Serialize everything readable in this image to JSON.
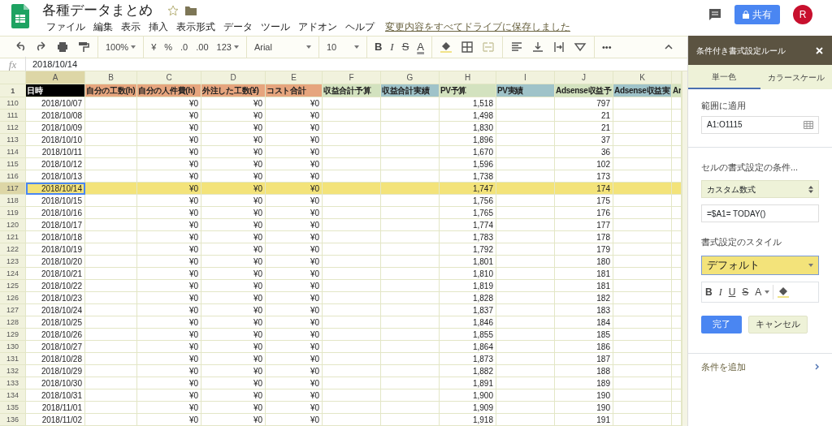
{
  "document": {
    "title": "各種データまとめ",
    "save_status": "変更内容をすべてドライブに保存しました"
  },
  "menus": [
    "ファイル",
    "編集",
    "表示",
    "挿入",
    "表示形式",
    "データ",
    "ツール",
    "アドオン",
    "ヘルプ"
  ],
  "share_button": {
    "label": "共有"
  },
  "avatar": {
    "initial": "R"
  },
  "toolbar": [
    {
      "kind": "undo"
    },
    {
      "kind": "redo"
    },
    {
      "kind": "print"
    },
    {
      "kind": "paint"
    },
    {
      "kind": "sep"
    },
    {
      "kind": "dropdown",
      "text": "100%"
    },
    {
      "kind": "sep"
    },
    {
      "kind": "text",
      "text": "¥"
    },
    {
      "kind": "text",
      "text": "%"
    },
    {
      "kind": "text",
      "text": ".0"
    },
    {
      "kind": "text",
      "text": ".00"
    },
    {
      "kind": "dropdown",
      "text": "123"
    },
    {
      "kind": "sep"
    },
    {
      "kind": "wide",
      "text": "Arial"
    },
    {
      "kind": "sep"
    },
    {
      "kind": "wide",
      "text": "10"
    },
    {
      "kind": "sep"
    },
    {
      "kind": "bold",
      "text": "B"
    },
    {
      "kind": "italic",
      "text": "I"
    },
    {
      "kind": "strike",
      "text": "S"
    },
    {
      "kind": "color",
      "text": "A"
    },
    {
      "kind": "sep"
    },
    {
      "kind": "fill"
    },
    {
      "kind": "borders"
    },
    {
      "kind": "merge"
    },
    {
      "kind": "sep"
    },
    {
      "kind": "align"
    },
    {
      "kind": "valign"
    },
    {
      "kind": "wrap"
    },
    {
      "kind": "rotate"
    },
    {
      "kind": "sep"
    },
    {
      "kind": "text",
      "text": "•••"
    }
  ],
  "formula_bar": {
    "label": "fx",
    "value": "2018/10/14"
  },
  "sheet": {
    "header_row_number": "1",
    "columns": [
      {
        "letter": "A",
        "header": "日時",
        "color": "#000000",
        "selected": true
      },
      {
        "letter": "B",
        "header": "自分の工数(h)",
        "color": "#e6a57e",
        "selected": false
      },
      {
        "letter": "C",
        "header": "自分の人件費(h)",
        "color": "#e6a57e",
        "selected": false
      },
      {
        "letter": "D",
        "header": "外注した工数(¥)",
        "color": "#e6a57e",
        "selected": false
      },
      {
        "letter": "E",
        "header": "コスト合計",
        "color": "#e6a57e",
        "selected": false
      },
      {
        "letter": "F",
        "header": "収益合計予算",
        "color": "#d3e2bf",
        "selected": false
      },
      {
        "letter": "G",
        "header": "収益合計実績",
        "color": "#9fc3c9",
        "selected": false
      },
      {
        "letter": "H",
        "header": "PV予算",
        "color": "#d3e2bf",
        "selected": false
      },
      {
        "letter": "I",
        "header": "PV実績",
        "color": "#9fc3c9",
        "selected": false
      },
      {
        "letter": "J",
        "header": "Adsense収益予",
        "color": "#d3e2bf",
        "selected": false
      },
      {
        "letter": "K",
        "header": "Adsense収益実",
        "color": "#9fc3c9",
        "selected": false
      },
      {
        "header": "Ar",
        "color": "#d3e2bf",
        "selected": false
      }
    ],
    "rows": [
      {
        "number": "110",
        "selected": false,
        "cells": {
          "A": "2018/10/07",
          "C": "¥0",
          "D": "¥0",
          "E": "¥0",
          "H": "1,518",
          "J": "797"
        }
      },
      {
        "number": "111",
        "selected": false,
        "cells": {
          "A": "2018/10/08",
          "C": "¥0",
          "D": "¥0",
          "E": "¥0",
          "H": "1,498",
          "J": "21"
        }
      },
      {
        "number": "112",
        "selected": false,
        "cells": {
          "A": "2018/10/09",
          "C": "¥0",
          "D": "¥0",
          "E": "¥0",
          "H": "1,830",
          "J": "21"
        }
      },
      {
        "number": "113",
        "selected": false,
        "cells": {
          "A": "2018/10/10",
          "C": "¥0",
          "D": "¥0",
          "E": "¥0",
          "H": "1,896",
          "J": "37"
        }
      },
      {
        "number": "114",
        "selected": false,
        "cells": {
          "A": "2018/10/11",
          "C": "¥0",
          "D": "¥0",
          "E": "¥0",
          "H": "1,670",
          "J": "36"
        }
      },
      {
        "number": "115",
        "selected": false,
        "cells": {
          "A": "2018/10/12",
          "C": "¥0",
          "D": "¥0",
          "E": "¥0",
          "H": "1,596",
          "J": "102"
        }
      },
      {
        "number": "116",
        "selected": false,
        "cells": {
          "A": "2018/10/13",
          "C": "¥0",
          "D": "¥0",
          "E": "¥0",
          "H": "1,738",
          "J": "173"
        }
      },
      {
        "number": "117",
        "selected": true,
        "cells": {
          "A": "2018/10/14",
          "C": "¥0",
          "D": "¥0",
          "E": "¥0",
          "H": "1,747",
          "J": "174"
        }
      },
      {
        "number": "118",
        "selected": false,
        "cells": {
          "A": "2018/10/15",
          "C": "¥0",
          "D": "¥0",
          "E": "¥0",
          "H": "1,756",
          "J": "175"
        }
      },
      {
        "number": "119",
        "selected": false,
        "cells": {
          "A": "2018/10/16",
          "C": "¥0",
          "D": "¥0",
          "E": "¥0",
          "H": "1,765",
          "J": "176"
        }
      },
      {
        "number": "120",
        "selected": false,
        "cells": {
          "A": "2018/10/17",
          "C": "¥0",
          "D": "¥0",
          "E": "¥0",
          "H": "1,774",
          "J": "177"
        }
      },
      {
        "number": "121",
        "selected": false,
        "cells": {
          "A": "2018/10/18",
          "C": "¥0",
          "D": "¥0",
          "E": "¥0",
          "H": "1,783",
          "J": "178"
        }
      },
      {
        "number": "122",
        "selected": false,
        "cells": {
          "A": "2018/10/19",
          "C": "¥0",
          "D": "¥0",
          "E": "¥0",
          "H": "1,792",
          "J": "179"
        }
      },
      {
        "number": "123",
        "selected": false,
        "cells": {
          "A": "2018/10/20",
          "C": "¥0",
          "D": "¥0",
          "E": "¥0",
          "H": "1,801",
          "J": "180"
        }
      },
      {
        "number": "124",
        "selected": false,
        "cells": {
          "A": "2018/10/21",
          "C": "¥0",
          "D": "¥0",
          "E": "¥0",
          "H": "1,810",
          "J": "181"
        }
      },
      {
        "number": "125",
        "selected": false,
        "cells": {
          "A": "2018/10/22",
          "C": "¥0",
          "D": "¥0",
          "E": "¥0",
          "H": "1,819",
          "J": "181"
        }
      },
      {
        "number": "126",
        "selected": false,
        "cells": {
          "A": "2018/10/23",
          "C": "¥0",
          "D": "¥0",
          "E": "¥0",
          "H": "1,828",
          "J": "182"
        }
      },
      {
        "number": "127",
        "selected": false,
        "cells": {
          "A": "2018/10/24",
          "C": "¥0",
          "D": "¥0",
          "E": "¥0",
          "H": "1,837",
          "J": "183"
        }
      },
      {
        "number": "128",
        "selected": false,
        "cells": {
          "A": "2018/10/25",
          "C": "¥0",
          "D": "¥0",
          "E": "¥0",
          "H": "1,846",
          "J": "184"
        }
      },
      {
        "number": "129",
        "selected": false,
        "cells": {
          "A": "2018/10/26",
          "C": "¥0",
          "D": "¥0",
          "E": "¥0",
          "H": "1,855",
          "J": "185"
        }
      },
      {
        "number": "130",
        "selected": false,
        "cells": {
          "A": "2018/10/27",
          "C": "¥0",
          "D": "¥0",
          "E": "¥0",
          "H": "1,864",
          "J": "186"
        }
      },
      {
        "number": "131",
        "selected": false,
        "cells": {
          "A": "2018/10/28",
          "C": "¥0",
          "D": "¥0",
          "E": "¥0",
          "H": "1,873",
          "J": "187"
        }
      },
      {
        "number": "132",
        "selected": false,
        "cells": {
          "A": "2018/10/29",
          "C": "¥0",
          "D": "¥0",
          "E": "¥0",
          "H": "1,882",
          "J": "188"
        }
      },
      {
        "number": "133",
        "selected": false,
        "cells": {
          "A": "2018/10/30",
          "C": "¥0",
          "D": "¥0",
          "E": "¥0",
          "H": "1,891",
          "J": "189"
        }
      },
      {
        "number": "134",
        "selected": false,
        "cells": {
          "A": "2018/10/31",
          "C": "¥0",
          "D": "¥0",
          "E": "¥0",
          "H": "1,900",
          "J": "190"
        }
      },
      {
        "number": "135",
        "selected": false,
        "cells": {
          "A": "2018/11/01",
          "C": "¥0",
          "D": "¥0",
          "E": "¥0",
          "H": "1,909",
          "J": "190"
        }
      },
      {
        "number": "136",
        "selected": false,
        "cells": {
          "A": "2018/11/02",
          "C": "¥0",
          "D": "¥0",
          "E": "¥0",
          "H": "1,918",
          "J": "191"
        }
      }
    ]
  },
  "panel": {
    "title": "条件付き書式設定ルール",
    "tabs": [
      {
        "label": "単一色",
        "selected": true
      },
      {
        "label": "カラースケール",
        "selected": false
      }
    ],
    "range_label": "範囲に適用",
    "range_value": "A1:O1115",
    "condition_label": "セルの書式設定の条件...",
    "condition_select": "カスタム数式",
    "formula_value": "=$A1= TODAY()",
    "style_label": "書式設定のスタイル",
    "style_select": "デフォルト",
    "style_buttons": [
      {
        "kind": "bold",
        "text": "B"
      },
      {
        "kind": "italic",
        "text": "I"
      },
      {
        "kind": "underline",
        "text": "U"
      },
      {
        "kind": "strike",
        "text": "S"
      },
      {
        "kind": "color",
        "text": "A"
      },
      {
        "kind": "fill"
      }
    ],
    "done_button": "完了",
    "cancel_button": "キャンセル",
    "add_condition": "条件を追加"
  }
}
